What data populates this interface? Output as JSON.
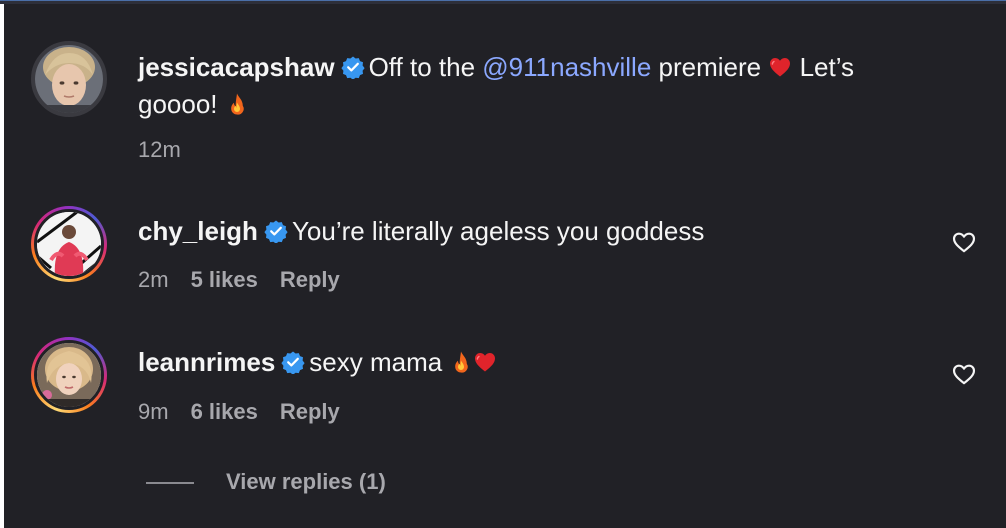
{
  "post": {
    "username": "jessicacapshaw",
    "caption_line1_pre": "Off to the ",
    "mention": "@911nashville",
    "caption_line1_post": " premiere ",
    "caption_line1_tail": " Let’s",
    "caption_line2": "goooo! ",
    "time": "12m"
  },
  "comments": [
    {
      "username": "chy_leigh",
      "text": "You’re literally ageless you goddess",
      "time": "2m",
      "likes": "5 likes",
      "reply_label": "Reply"
    },
    {
      "username": "leannrimes",
      "text": "sexy mama ",
      "time": "9m",
      "likes": "6 likes",
      "reply_label": "Reply",
      "view_replies": "View replies (1)"
    }
  ],
  "icons": {
    "verified": "verified-badge-icon",
    "heart": "heart-outline-icon",
    "fire": "fire-emoji",
    "red_heart": "red-heart-emoji"
  },
  "colors": {
    "background": "#212126",
    "text": "#f5f5f5",
    "secondary_text": "#a8a8ad",
    "mention": "#8ba8ff",
    "verified": "#3897f0"
  }
}
